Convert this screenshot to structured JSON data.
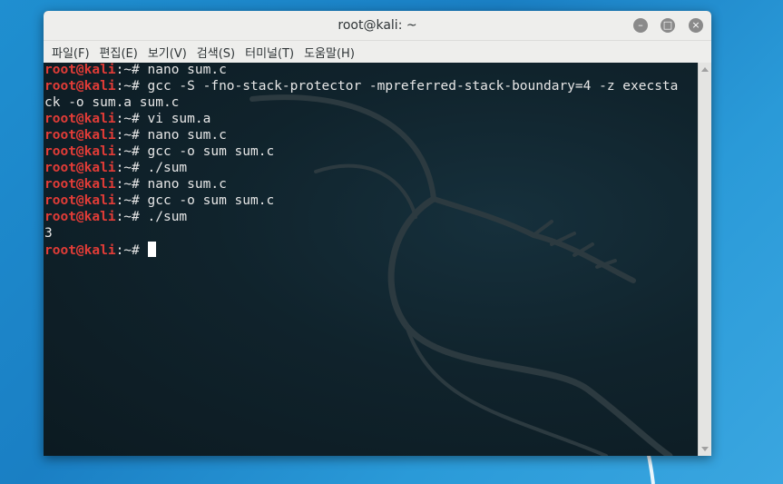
{
  "window": {
    "title": "root@kali: ~",
    "buttons": [
      {
        "name": "minimize",
        "glyph": "–"
      },
      {
        "name": "maximize",
        "glyph": "□"
      },
      {
        "name": "close",
        "glyph": "×"
      }
    ]
  },
  "menu": [
    "파일(F)",
    "편집(E)",
    "보기(V)",
    "검색(S)",
    "터미널(T)",
    "도움말(H)"
  ],
  "terminal": {
    "prompt_user": "root@kali",
    "prompt_path": ":~# ",
    "lines": [
      {
        "type": "cmd",
        "text": "nano sum.c"
      },
      {
        "type": "cmd",
        "text": "gcc -S -fno-stack-protector -mpreferred-stack-boundary=4 -z execsta"
      },
      {
        "type": "out",
        "text": "ck -o sum.a sum.c"
      },
      {
        "type": "cmd",
        "text": "vi sum.a"
      },
      {
        "type": "cmd",
        "text": "nano sum.c"
      },
      {
        "type": "cmd",
        "text": "gcc -o sum sum.c"
      },
      {
        "type": "cmd",
        "text": "./sum"
      },
      {
        "type": "cmd",
        "text": "nano sum.c"
      },
      {
        "type": "cmd",
        "text": "gcc -o sum sum.c"
      },
      {
        "type": "cmd",
        "text": "./sum"
      },
      {
        "type": "out",
        "text": "3"
      },
      {
        "type": "cmd",
        "text": "",
        "cursor": true
      }
    ]
  },
  "colors": {
    "prompt_user": "#e23c37",
    "terminal_bg": "#0f1c23",
    "desktop_bg": "#1f8fd0"
  }
}
